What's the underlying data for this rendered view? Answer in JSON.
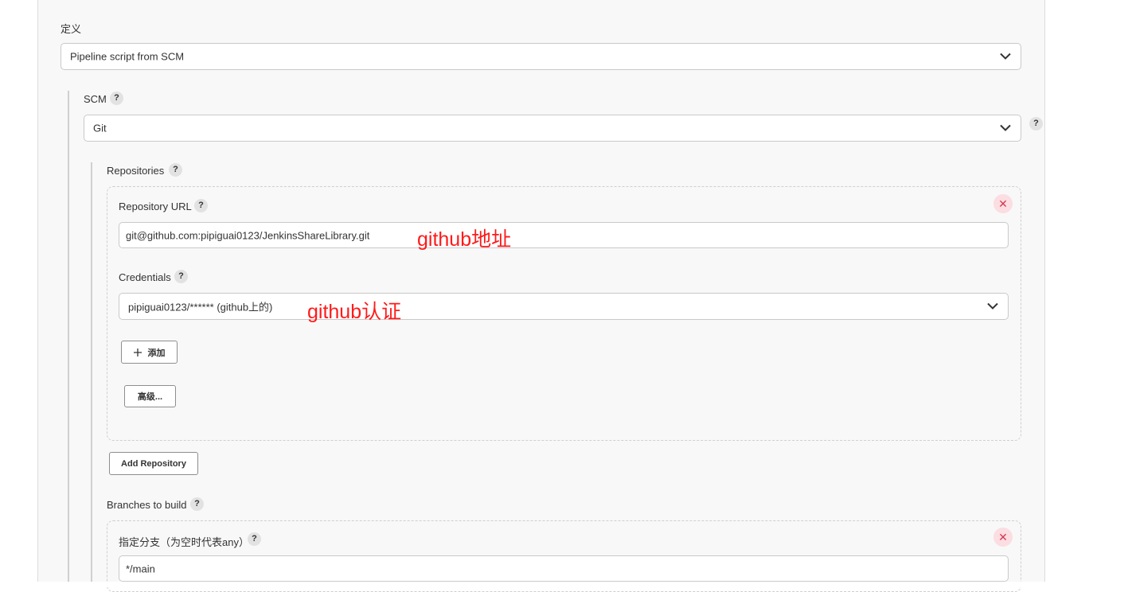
{
  "definition": {
    "label": "定义",
    "selected": "Pipeline script from SCM"
  },
  "scm": {
    "label": "SCM",
    "selected": "Git"
  },
  "repositories": {
    "label": "Repositories",
    "url_label": "Repository URL",
    "url_value": "git@github.com:pipiguai0123/JenkinsShareLibrary.git",
    "credentials_label": "Credentials",
    "credentials_value": "pipiguai0123/****** (github上的)",
    "add_label": "添加",
    "advanced_label": "高级...",
    "add_repository_label": "Add Repository"
  },
  "branches": {
    "label": "Branches to build",
    "spec_label": "指定分支（为空时代表any）",
    "spec_value": "*/main"
  },
  "annotations": {
    "url_note": "github地址",
    "cred_note": "github认证"
  },
  "help_glyph": "?",
  "close_glyph": "✕",
  "colors": {
    "annotation": "#ff1a1a",
    "close_bg": "#fbdde2",
    "close_fg": "#d53a4f"
  }
}
